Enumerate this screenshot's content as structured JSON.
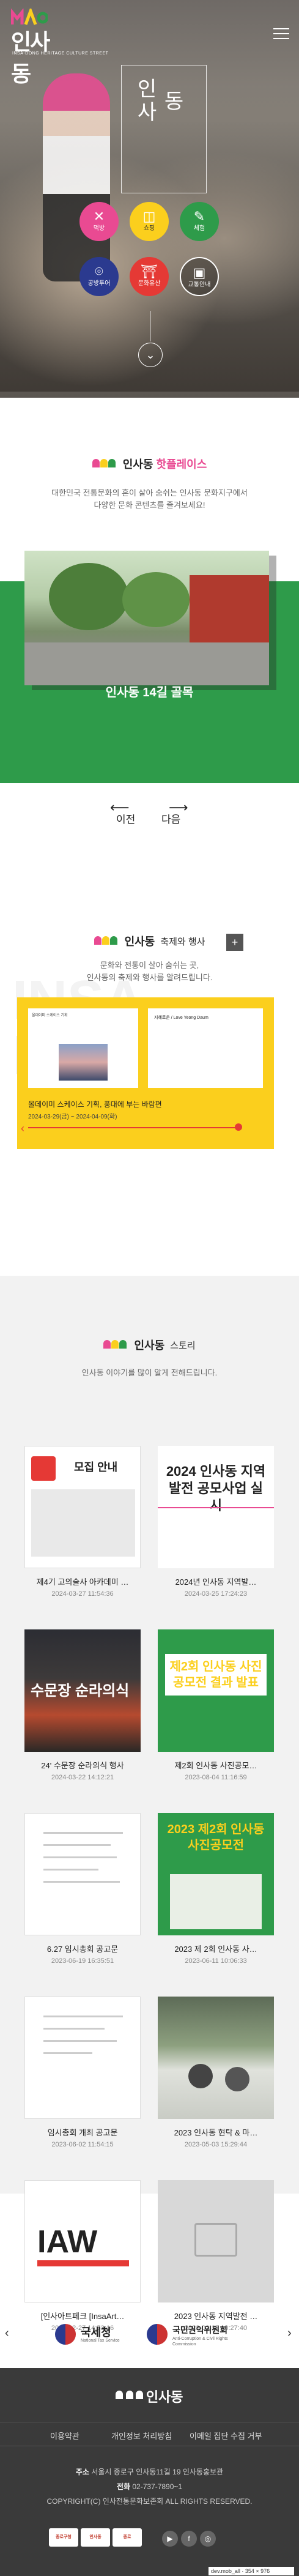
{
  "hero": {
    "logo_text": "인사동",
    "logo_sub": "INSA-DONG HERITAGE CULTURE STREET",
    "calligraphy_1": "인사",
    "calligraphy_2": "동",
    "quick_menu": [
      {
        "label": "먹방",
        "icon": "utensils-icon",
        "color": "#e94a92"
      },
      {
        "label": "쇼핑",
        "icon": "shopping-bag-icon",
        "color": "#fbcf1d"
      },
      {
        "label": "체험",
        "icon": "brush-icon",
        "color": "#2e9b4a"
      },
      {
        "label": "공방투어",
        "icon": "map-pin-icon",
        "color": "#2b3a8f"
      },
      {
        "label": "문화유산",
        "icon": "gate-icon",
        "color": "#e53935"
      },
      {
        "label": "교통안내",
        "icon": "bus-icon",
        "color": "#333333"
      }
    ]
  },
  "hotplace": {
    "brand": "인사동",
    "title": "핫플레이스",
    "desc_line1": "대한민국 전통문화의 혼이 살아 숨쉬는 인사동 문화지구에서",
    "desc_line2": "다양한 문화 콘텐츠를 즐겨보세요!",
    "place_name": "인사동 14길 골목",
    "prev_label": "이전",
    "next_label": "다음"
  },
  "festival": {
    "brand": "인사동",
    "title": "축제와 행사",
    "desc_line1": "문화와 전통이 살아 숨쉬는 곳,",
    "desc_line2": "인사동의 축제와 행사를 알려드립니다.",
    "plus": "+",
    "watermark": "INSA DONG",
    "poster_text": "올데이미 스케이스 기획",
    "poster_right": "지혜로운 / Love Yeong Daum",
    "event_title": "올데이미 스케이스 기획, 풍대에 부는 바람편",
    "event_date": "2024-03-29(금) ~ 2024-04-09(화)"
  },
  "story": {
    "brand": "인사동",
    "title": "스토리",
    "desc": "인사동 이야기를 많이 알게 전해드립니다.",
    "cards": [
      {
        "title": "제4기 고의술사 아카데미 …",
        "date": "2024-03-27 11:54:36",
        "thumb": "모집 안내"
      },
      {
        "title": "2024년 인사동 지역발…",
        "date": "2024-03-25 17:24:23",
        "thumb": "2024 인사동 지역발전 공모사업 실시"
      },
      {
        "title": "24' 수문장 순라의식 행사",
        "date": "2024-03-22 14:12:21",
        "thumb": "수문장 순라의식"
      },
      {
        "title": "제2회 인사동 사진공모…",
        "date": "2023-08-04 11:16:59",
        "thumb": "제2회 인사동 사진공모전 결과 발표"
      },
      {
        "title": "6.27 임시총회 공고문",
        "date": "2023-06-19 16:35:51",
        "thumb": ""
      },
      {
        "title": "2023 제 2회 인사동 사…",
        "date": "2023-06-11 10:06:33",
        "thumb": "2023 제2회 인사동사진공모전"
      },
      {
        "title": "임시총회 개최 공고문",
        "date": "2023-06-02 11:54:15",
        "thumb": ""
      },
      {
        "title": "2023 인사동 현탁 & 마…",
        "date": "2023-05-03 15:29:44",
        "thumb": ""
      },
      {
        "title": "[인사아트페크 [InsaArt…",
        "date": "2023-02-27 14:53:16",
        "thumb": "IAW"
      },
      {
        "title": "2023 인사동 지역발전 …",
        "date": "2023-02-27 10:27:40",
        "thumb": ""
      }
    ]
  },
  "partners": [
    {
      "name": "국세청",
      "sub": "National Tax Service"
    },
    {
      "name": "국민권익위원회",
      "sub": "Anti-Corruption & Civil Rights Commission"
    }
  ],
  "footer": {
    "brand": "인사동",
    "links": [
      "이용약관",
      "개인정보 처리방침",
      "이메일 집단 수집 거부"
    ],
    "address_label": "주소",
    "address": "서울시 종로구 인사동11길 19 인사동홍보관",
    "phone_label": "전화",
    "phone": "02-737-7890~1",
    "copyright": "COPYRIGHT(C) 인사전통문화보존회 ALL RIGHTS RESERVED.",
    "badges": [
      "종로구청",
      "인사동",
      "종로"
    ],
    "url": "dev.mob_all · 354 × 976"
  }
}
